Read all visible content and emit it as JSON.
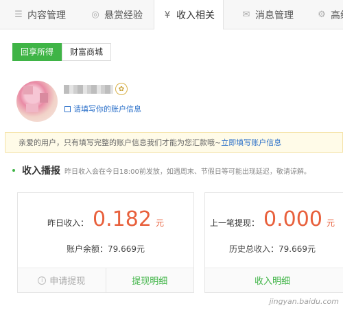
{
  "nav": {
    "tabs": [
      {
        "label": "内容管理",
        "icon": "list-icon"
      },
      {
        "label": "悬赏经验",
        "icon": "coin-icon"
      },
      {
        "label": "收入相关",
        "icon": "yen-icon"
      },
      {
        "label": "消息管理",
        "icon": "mail-icon"
      },
      {
        "label": "高级",
        "icon": "gear-icon"
      }
    ],
    "active": "收入相关"
  },
  "subtabs": [
    {
      "label": "回享所得",
      "active": true
    },
    {
      "label": "财富商城",
      "active": false
    }
  ],
  "user": {
    "fill_info_link": "请填写你的账户信息"
  },
  "notice": {
    "text": "亲爱的用户，只有填写完整的账户信息我们才能为您汇款哦~",
    "link": "立即填写账户信息"
  },
  "section": {
    "title": "收入播报",
    "note": "昨日收入会在今日18:00前发放，如遇周末、节假日等可能出现延迟，敬请谅解。"
  },
  "cards": [
    {
      "label": "昨日收入：",
      "value": "0.182",
      "unit": "元",
      "sub": "账户余额：79.669元",
      "actions": [
        "申请提现",
        "提现明细"
      ]
    },
    {
      "label": "上一笔提现：",
      "value": "0.000",
      "unit": "元",
      "sub": "历史总收入：79.669元",
      "actions": [
        "收入明细"
      ]
    }
  ],
  "colors": {
    "green": "#3fb446",
    "orange": "#e8603c",
    "link": "#2a6fc9"
  },
  "watermark": "jingyan.baidu.com"
}
